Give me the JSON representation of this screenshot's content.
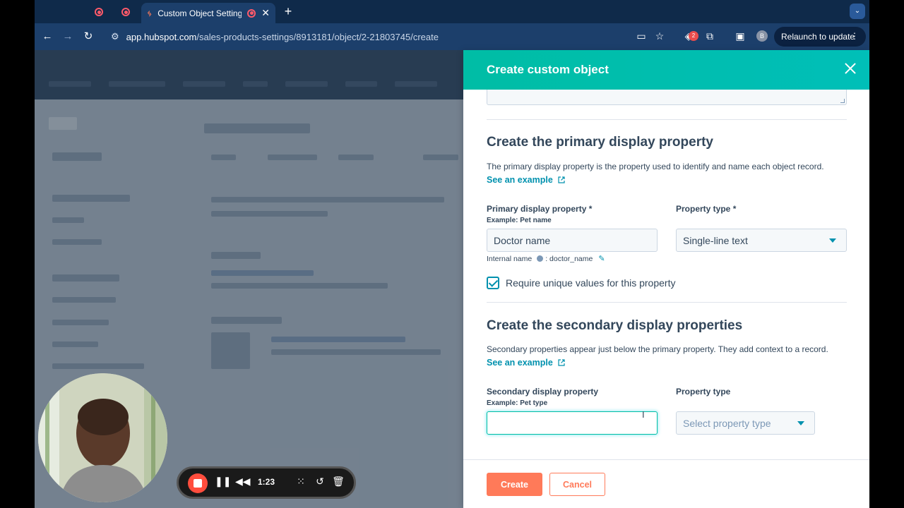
{
  "browser": {
    "active_tab_title": "Custom Object Settings",
    "url_host": "app.hubspot.com",
    "url_path": "/sales-products-settings/8913181/object/2-21803745/create",
    "extension_badge": "2",
    "profile_initial": "B",
    "relaunch_label": "Relaunch to update"
  },
  "panel": {
    "title": "Create custom object",
    "primary_section": {
      "title": "Create the primary display property",
      "description": "The primary display property is the property used to identify and name each object record.",
      "see_example": "See an example",
      "property_label": "Primary display property *",
      "property_hint": "Example: Pet name",
      "property_value": "Doctor name",
      "type_label": "Property type *",
      "type_value": "Single-line text",
      "internal_name_label": "Internal name",
      "internal_name_value": ": doctor_name",
      "unique_checkbox_label": "Require unique values for this property",
      "unique_checked": true
    },
    "secondary_section": {
      "title": "Create the secondary display properties",
      "description": "Secondary properties appear just below the primary property. They add context to a record.",
      "see_example": "See an example",
      "property_label": "Secondary display property",
      "property_hint": "Example: Pet type",
      "property_value": "",
      "type_label": "Property type",
      "type_placeholder": "Select property type"
    },
    "footer": {
      "create_label": "Create",
      "cancel_label": "Cancel"
    }
  },
  "recorder": {
    "time": "1:23"
  },
  "colors": {
    "header_teal": "#00bda5",
    "accent_orange": "#ff7a59",
    "link_blue": "#0091ae",
    "text_dark": "#33475b"
  }
}
